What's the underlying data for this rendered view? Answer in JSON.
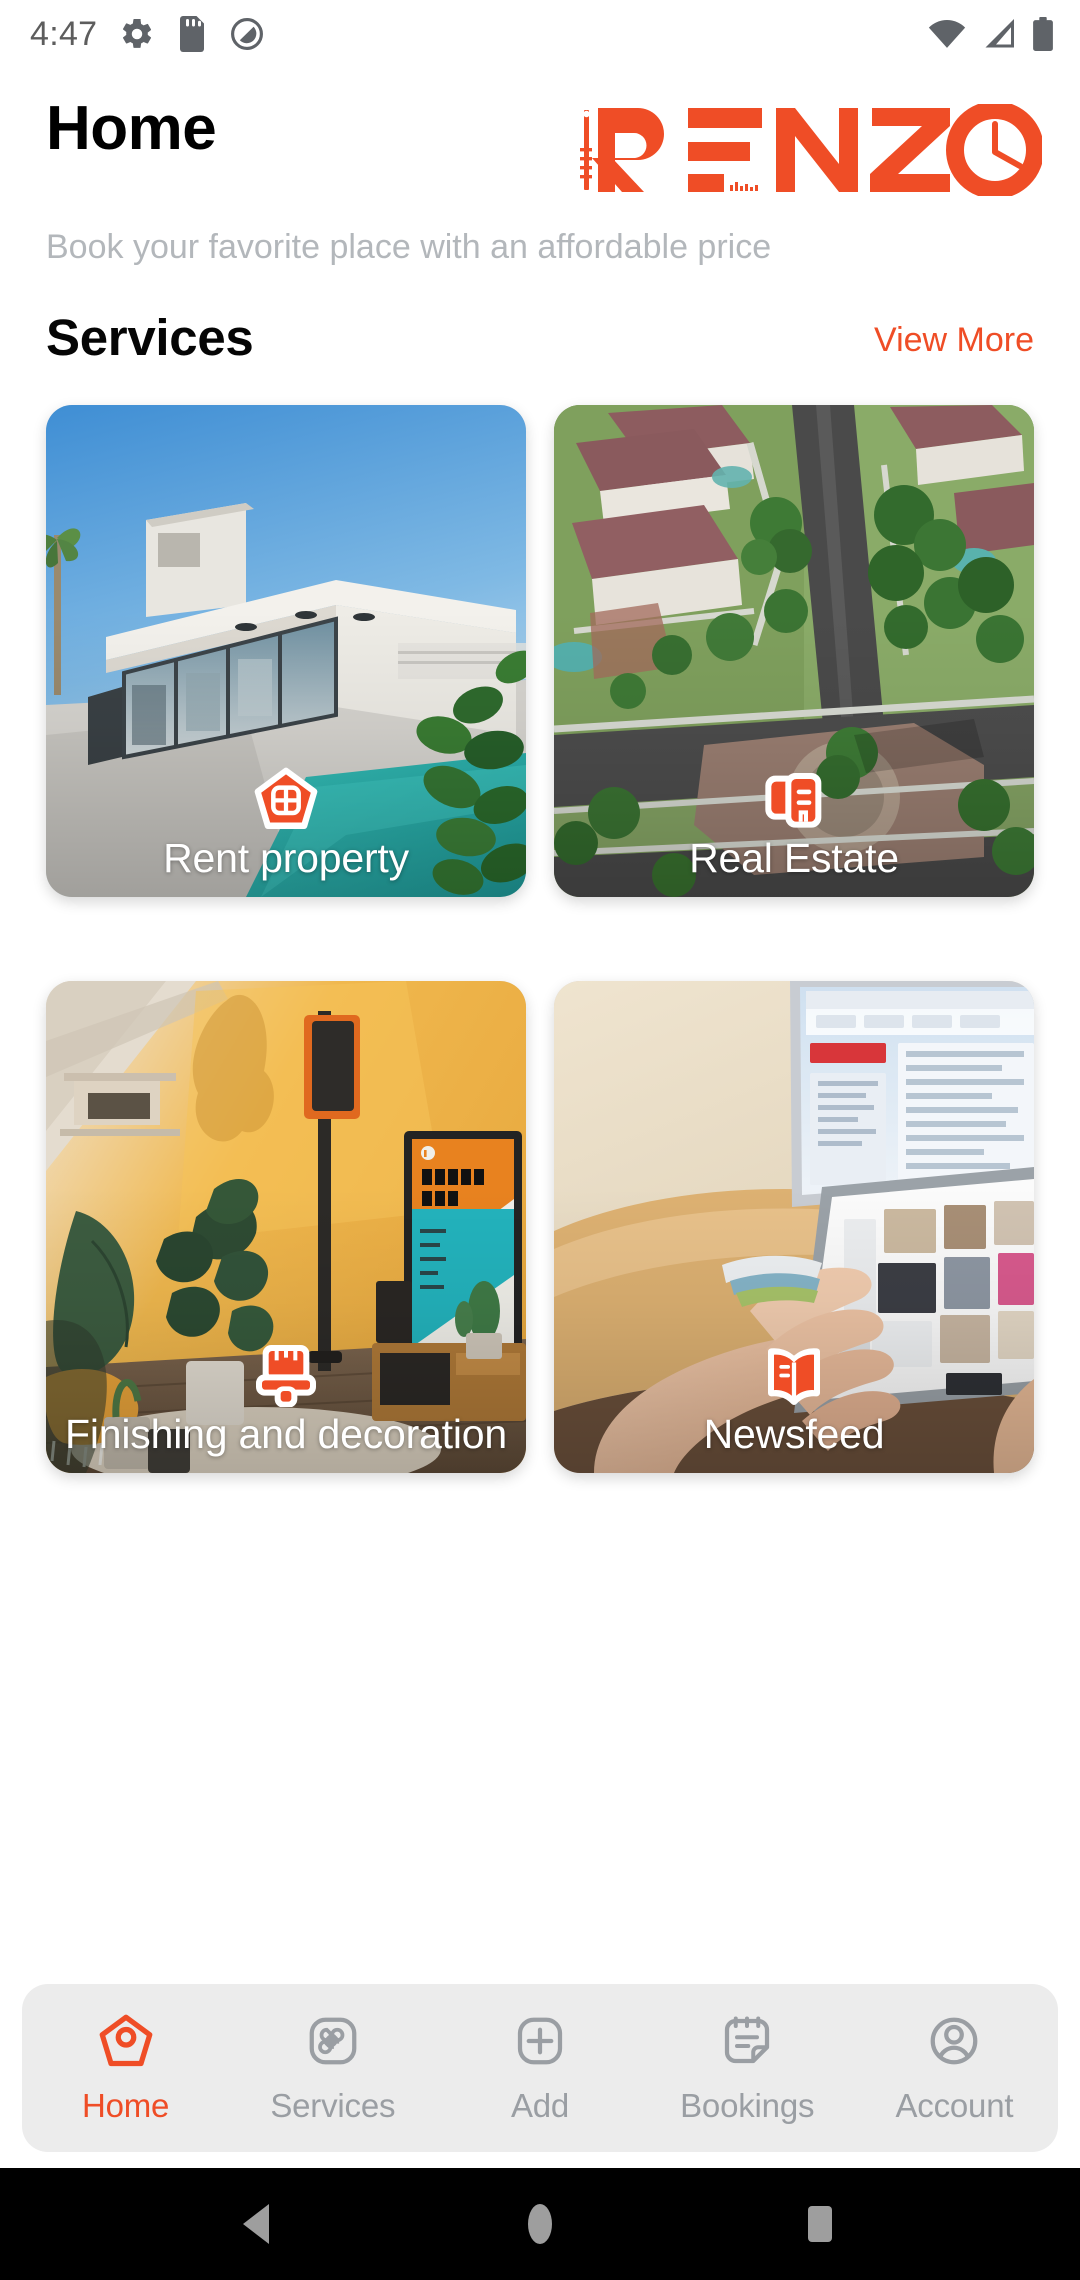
{
  "status_bar": {
    "time": "4:47",
    "left_icons": [
      "gear-icon",
      "sd-card-icon",
      "circle-q-icon"
    ],
    "right_icons": [
      "wifi-icon",
      "cellular-signal-icon",
      "battery-full-icon"
    ],
    "icon_color": "#5f6368"
  },
  "header": {
    "title": "Home",
    "logo_text": "RENZO",
    "logo_color": "#ef4d26",
    "subtitle": "Book your favorite place with an affordable price"
  },
  "section": {
    "title": "Services",
    "view_more_label": "View More",
    "view_more_color": "#ef4d26"
  },
  "services": [
    {
      "label": "Rent property",
      "icon": "house-window-icon",
      "image": "modern-white-villa-with-pool"
    },
    {
      "label": "Real Estate",
      "icon": "buildings-icon",
      "image": "aerial-view-suburban-neighborhood"
    },
    {
      "label": "Finishing and decoration",
      "icon": "paint-brush-icon",
      "image": "warm-lit-interior-room-with-plants"
    },
    {
      "label": "Newsfeed",
      "icon": "open-book-icon",
      "image": "hands-using-laptop-touchscreen"
    }
  ],
  "bottom_nav": {
    "active_color": "#ef4d26",
    "inactive_color": "#9a9ea3",
    "background": "#ececec",
    "items": [
      {
        "label": "Home",
        "icon": "home-pin-icon",
        "active": true
      },
      {
        "label": "Services",
        "icon": "command-icon",
        "active": false
      },
      {
        "label": "Add",
        "icon": "plus-box-icon",
        "active": false
      },
      {
        "label": "Bookings",
        "icon": "notepad-icon",
        "active": false
      },
      {
        "label": "Account",
        "icon": "person-circle-icon",
        "active": false
      }
    ]
  },
  "android_nav": {
    "back": "back-triangle-icon",
    "home": "home-circle-icon",
    "recents": "recents-square-icon",
    "color": "#9e9e9e",
    "background": "#000000"
  }
}
